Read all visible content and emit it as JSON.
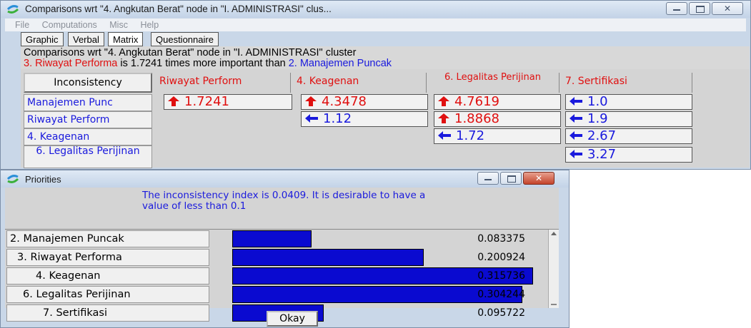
{
  "main_window": {
    "title": "Comparisons wrt \"4. Angkutan Berat\" node in \"I. ADMINISTRASI\" clus...",
    "menu": [
      "File",
      "Computations",
      "Misc",
      "Help"
    ],
    "tabs": [
      "Graphic",
      "Verbal",
      "Matrix",
      "Questionnaire"
    ],
    "active_tab": "Matrix",
    "header_line1": "Comparisons wrt \"4. Angkutan Berat\" node in \"I. ADMINISTRASI\" cluster",
    "header_line2": {
      "part1": "3. Riwayat Performa",
      "part2": " is 1.7241 times more important than ",
      "part3": "2. Manajemen Puncak"
    },
    "inconsistency_button": "Inconsistency",
    "columns": [
      "Riwayat Perform",
      "4. Keagenan",
      "6. Legalitas Perijinan",
      "7. Sertifikasi"
    ],
    "rows": [
      "Manajemen Punc",
      "Riwayat Perform",
      "4. Keagenan",
      "6. Legalitas Perijinan"
    ],
    "cells": [
      {
        "value": "1.7241",
        "dir": "up"
      },
      {
        "value": "4.3478",
        "dir": "up"
      },
      {
        "value": "4.7619",
        "dir": "up"
      },
      {
        "value": "1.0",
        "dir": "left"
      },
      {
        "value": "1.12",
        "dir": "left"
      },
      {
        "value": "1.8868",
        "dir": "up"
      },
      {
        "value": "1.9",
        "dir": "left"
      },
      {
        "value": "1.72",
        "dir": "left"
      },
      {
        "value": "2.67",
        "dir": "left"
      },
      {
        "value": "3.27",
        "dir": "left"
      }
    ]
  },
  "priorities_window": {
    "title": "Priorities",
    "note": "The inconsistency index is 0.0409.  It is desirable to have a value of less than 0.1",
    "items": [
      {
        "label": "2. Manajemen Puncak",
        "value": "0.083375",
        "priority": 0.083375
      },
      {
        "label": "3. Riwayat Performa",
        "value": "0.200924",
        "priority": 0.200924
      },
      {
        "label": "4. Keagenan",
        "value": "0.315736",
        "priority": 0.315736
      },
      {
        "label": "6. Legalitas Perijinan",
        "value": "0.304244",
        "priority": 0.304244
      },
      {
        "label": "7. Sertifikasi",
        "value": "0.095722",
        "priority": 0.095722
      }
    ],
    "okay_button": "Okay"
  },
  "colors": {
    "up_arrow": "#e01010",
    "left_arrow": "#1a1add",
    "bar": "#0a0ad0"
  }
}
